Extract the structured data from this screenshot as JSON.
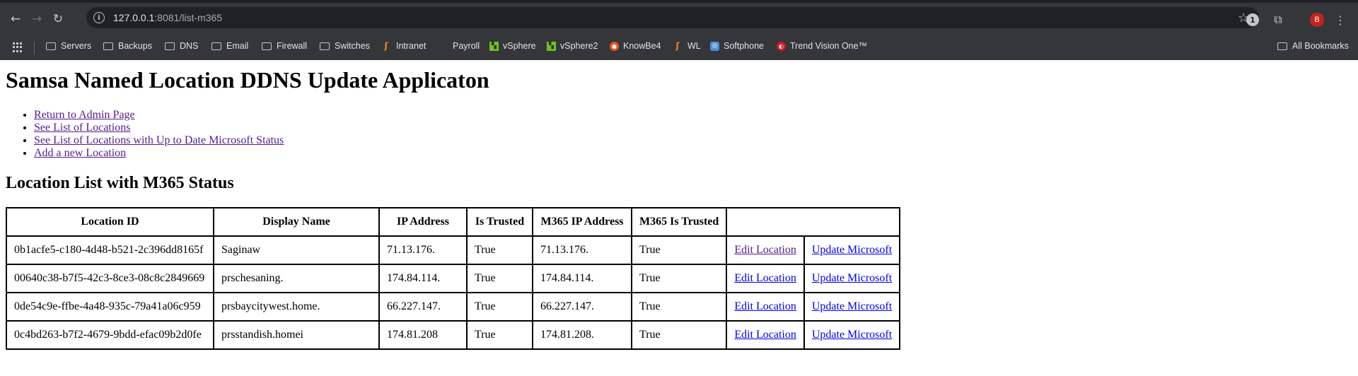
{
  "browser": {
    "url_host": "127.0.0.1",
    "url_rest": ":8081/list-m365",
    "avatar_initial": "B",
    "bookmarks": [
      {
        "label": "Servers",
        "icon": "folder-icon"
      },
      {
        "label": "Backups",
        "icon": "folder-icon"
      },
      {
        "label": "DNS",
        "icon": "folder-icon"
      },
      {
        "label": "Email",
        "icon": "folder-icon"
      },
      {
        "label": "Firewall",
        "icon": "folder-icon"
      },
      {
        "label": "Switches",
        "icon": "folder-icon"
      },
      {
        "label": "Intranet",
        "icon": "intranet-favicon"
      },
      {
        "label": "Payroll",
        "icon": "blank-favicon"
      },
      {
        "label": "vSphere",
        "icon": "vsphere-favicon"
      },
      {
        "label": "vSphere2",
        "icon": "vsphere-favicon"
      },
      {
        "label": "KnowBe4",
        "icon": "knowbe4-favicon"
      },
      {
        "label": "WL",
        "icon": "wl-favicon"
      },
      {
        "label": "Softphone",
        "icon": "softphone-favicon"
      },
      {
        "label": "Trend Vision One™",
        "icon": "trend-favicon"
      }
    ],
    "all_bookmarks_label": "All Bookmarks"
  },
  "page": {
    "title": "Samsa Named Location DDNS Update Applicaton",
    "links": [
      {
        "label": "Return to Admin Page"
      },
      {
        "label": "See List of Locations"
      },
      {
        "label": "See List of Locations with Up to Date Microsoft Status"
      },
      {
        "label": "Add a new Location"
      }
    ],
    "section_title": "Location List with M365 Status"
  },
  "table": {
    "headers": [
      "Location ID",
      "Display Name",
      "IP Address",
      "Is Trusted",
      "M365 IP Address",
      "M365 Is Trusted",
      ""
    ],
    "rows": [
      {
        "id": "0b1acfe5-c180-4d48-b521-2c396dd8165f",
        "name": "Saginaw",
        "ip": "71.13.176.",
        "trusted": "True",
        "m365_ip": "71.13.176.",
        "m365_trusted": "True",
        "edit": "Edit Location",
        "update": "Update Microsoft"
      },
      {
        "id": "00640c38-b7f5-42c3-8ce3-08c8c2849669",
        "name": "prschesaning.",
        "ip": "174.84.114.",
        "trusted": "True",
        "m365_ip": "174.84.114.",
        "m365_trusted": "True",
        "edit": "Edit Location",
        "update": "Update Microsoft"
      },
      {
        "id": "0de54c9e-ffbe-4a48-935c-79a41a06c959",
        "name": "prsbaycitywest.home.",
        "ip": "66.227.147.",
        "trusted": "True",
        "m365_ip": "66.227.147.",
        "m365_trusted": "True",
        "edit": "Edit Location",
        "update": "Update Microsoft"
      },
      {
        "id": "0c4bd263-b7f2-4679-9bdd-efac09b2d0fe",
        "name": "prsstandish.homei",
        "ip": "174.81.208",
        "trusted": "True",
        "m365_ip": "174.81.208.",
        "m365_trusted": "True",
        "edit": "Edit Location",
        "update": "Update Microsoft"
      }
    ]
  }
}
